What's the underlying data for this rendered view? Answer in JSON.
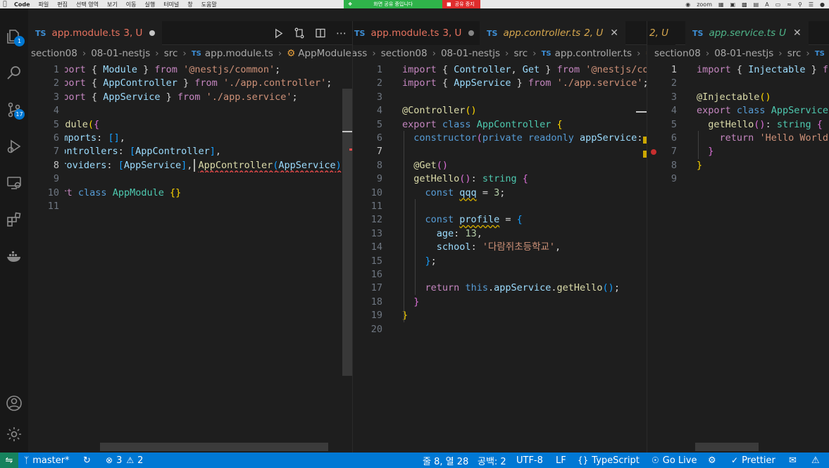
{
  "menubar": {
    "app": "Code",
    "items": [
      "파일",
      "편집",
      "선택 영역",
      "보기",
      "이동",
      "실행",
      "터미널",
      "창",
      "도움말"
    ],
    "share_status": "화면 공유 중입니다",
    "share_stop": "공유 중지",
    "zoom": "zoom"
  },
  "activity": {
    "explorer_badge": "1",
    "scm_badge": "17"
  },
  "group1": {
    "tab": {
      "lang": "TS",
      "name": "app.module.ts",
      "state": "3, U"
    },
    "crumbs": {
      "a": "section08",
      "b": "08-01-nestjs",
      "c": "src",
      "ts": "TS",
      "file": "app.module.ts",
      "symbol": "AppModule"
    },
    "lines": [
      "import { Module } from '@nestjs/common';",
      "import { AppController } from './app.controller';",
      "import { AppService } from './app.service';",
      "",
      "@Module({",
      "  imports: [],",
      "  controllers: [AppController],",
      "  providers: [AppService],",
      "})",
      "export class AppModule {}",
      ""
    ],
    "ghost_text": "AppController(AppService)"
  },
  "group2": {
    "tab_a": {
      "lang": "TS",
      "name": "app.module.ts",
      "state": "3, U"
    },
    "tab_b": {
      "lang": "TS",
      "name": "app.controller.ts",
      "state": "2, U"
    },
    "crumbs": {
      "a": "ass",
      "b": "section08",
      "c": "08-01-nestjs",
      "d": "src",
      "ts": "TS",
      "file": "app.controller.ts"
    },
    "lines": [
      "import { Controller, Get } from '@nestjs/comm",
      "import { AppService } from './app.service';",
      "",
      "@Controller()",
      "export class AppController {",
      "  constructor(private readonly appService: A",
      "",
      "  @Get()",
      "  getHello(): string {",
      "    const qqq = 3;",
      "",
      "    const profile = {",
      "      age: 13,",
      "      school: '다람쥐초등학교',",
      "    };",
      "",
      "    return this.appService.getHello();",
      "  }",
      "}",
      ""
    ]
  },
  "group3": {
    "tab_a": {
      "state": "2, U"
    },
    "tab_b": {
      "lang": "TS",
      "name": "app.service.ts",
      "state": "U"
    },
    "crumbs": {
      "a": "section08",
      "b": "08-01-nestjs",
      "c": "src",
      "ts": "TS"
    },
    "lines": [
      "import { Injectable } from",
      "",
      "@Injectable()",
      "export class AppService {",
      "  getHello(): string {",
      "    return 'Hello World!",
      "  }",
      "}",
      ""
    ]
  },
  "statusbar": {
    "branch": "master*",
    "errors": "3",
    "warnings": "2",
    "position": "줄 8, 열 28",
    "spaces": "공백: 2",
    "encoding": "UTF-8",
    "eol": "LF",
    "language": "TypeScript",
    "golive": "Go Live",
    "prettier": "Prettier"
  },
  "colors": {
    "accent": "#0078d4",
    "remote": "#16825d",
    "modified_tab": "#e8735f",
    "ts_icon": "#3d8fd6"
  }
}
